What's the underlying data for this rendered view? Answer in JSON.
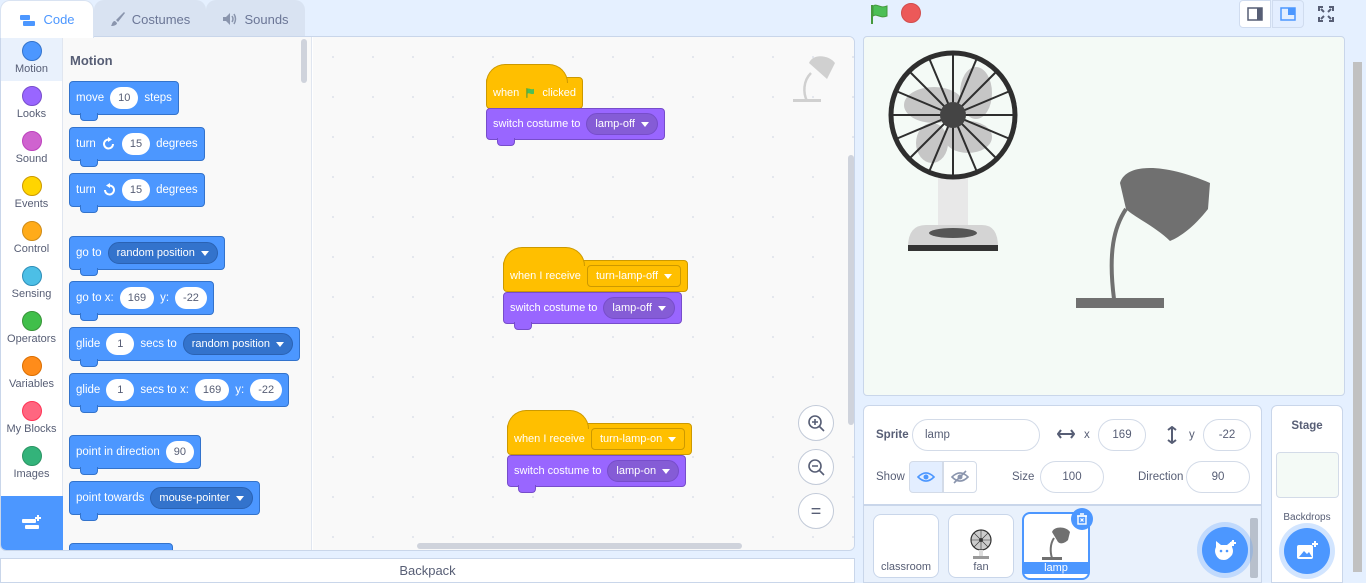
{
  "tabs": [
    {
      "label": "Code",
      "icon": "code-icon"
    },
    {
      "label": "Costumes",
      "icon": "paintbrush-icon"
    },
    {
      "label": "Sounds",
      "icon": "speaker-icon"
    }
  ],
  "categories": [
    {
      "label": "Motion",
      "color": "#4c97ff"
    },
    {
      "label": "Looks",
      "color": "#9966ff"
    },
    {
      "label": "Sound",
      "color": "#cf63cf"
    },
    {
      "label": "Events",
      "color": "#ffd500"
    },
    {
      "label": "Control",
      "color": "#ffab19"
    },
    {
      "label": "Sensing",
      "color": "#4cbfe6"
    },
    {
      "label": "Operators",
      "color": "#40bf4a"
    },
    {
      "label": "Variables",
      "color": "#ff8c1a"
    },
    {
      "label": "My Blocks",
      "color": "#ff6680"
    },
    {
      "label": "Images",
      "color": "#33b37a"
    }
  ],
  "palette": {
    "title": "Motion",
    "move": {
      "t1": "move",
      "v": "10",
      "t2": "steps"
    },
    "turn_right": {
      "t1": "turn",
      "v": "15",
      "t2": "degrees"
    },
    "turn_left": {
      "t1": "turn",
      "v": "15",
      "t2": "degrees"
    },
    "goto": {
      "t1": "go to",
      "d": "random position"
    },
    "goto_xy": {
      "t1": "go to x:",
      "x": "169",
      "t2": "y:",
      "y": "-22"
    },
    "glide": {
      "t1": "glide",
      "v": "1",
      "t2": "secs to",
      "d": "random position"
    },
    "glide_xy": {
      "t1": "glide",
      "v": "1",
      "t2": "secs to x:",
      "x": "169",
      "t3": "y:",
      "y": "-22"
    },
    "point_dir": {
      "t1": "point in direction",
      "v": "90"
    },
    "point_towards": {
      "t1": "point towards",
      "d": "mouse-pointer"
    }
  },
  "scripts": {
    "s1": {
      "hat1": "when",
      "hat2": "clicked",
      "looks": "switch costume to",
      "costume": "lamp-off"
    },
    "s2": {
      "hat": "when I receive",
      "msg": "turn-lamp-off",
      "looks": "switch costume to",
      "costume": "lamp-off"
    },
    "s3": {
      "hat": "when I receive",
      "msg": "turn-lamp-on",
      "looks": "switch costume to",
      "costume": "lamp-on"
    }
  },
  "zoom": {
    "in": "+",
    "out": "−",
    "reset": "="
  },
  "backpack": "Backpack",
  "sprite": {
    "label": "Sprite",
    "name": "lamp",
    "x_label": "x",
    "x": "169",
    "y_label": "y",
    "y": "-22",
    "show_label": "Show",
    "size_label": "Size",
    "size": "100",
    "direction_label": "Direction",
    "direction": "90"
  },
  "sprites": [
    "classroom",
    "fan",
    "lamp"
  ],
  "stage_panel": {
    "title": "Stage",
    "backdrops": "Backdrops"
  }
}
